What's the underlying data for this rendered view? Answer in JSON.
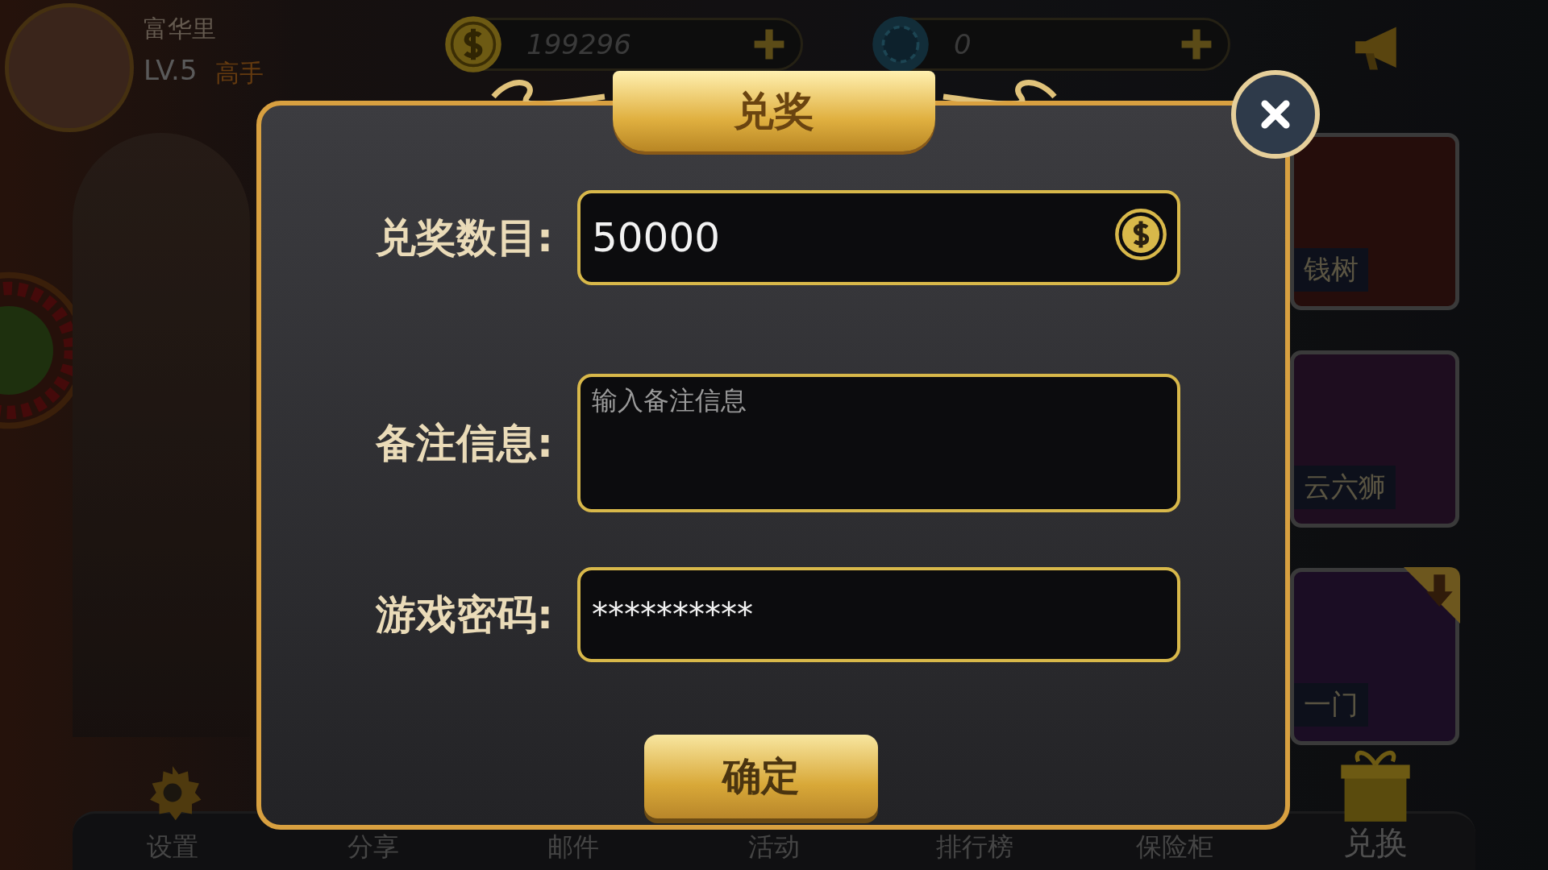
{
  "profile": {
    "name": "富华里",
    "level": "LV.5",
    "rank": "高手"
  },
  "currencies": [
    {
      "kind": "coin",
      "amount": "199296"
    },
    {
      "kind": "chip",
      "amount": "0"
    }
  ],
  "games": [
    {
      "title": "钱树",
      "kind": "coins",
      "download": false
    },
    {
      "title": "云六狮",
      "kind": "lion",
      "download": false
    },
    {
      "title": "一门",
      "kind": "cards",
      "download": true
    }
  ],
  "bottom_nav": [
    {
      "label": "设置",
      "kind": "gear"
    },
    {
      "label": "分享",
      "kind": "plain"
    },
    {
      "label": "邮件",
      "kind": "plain"
    },
    {
      "label": "活动",
      "kind": "plain"
    },
    {
      "label": "排行榜",
      "kind": "plain"
    },
    {
      "label": "保险柜",
      "kind": "plain"
    },
    {
      "label": "兑换",
      "kind": "gift"
    }
  ],
  "dialog": {
    "title": "兑奖",
    "fields": [
      {
        "label": "兑奖数目:",
        "kind": "amount",
        "value": "50000"
      },
      {
        "label": "备注信息:",
        "kind": "multiline",
        "placeholder": "输入备注信息"
      },
      {
        "label": "游戏密码:",
        "kind": "password",
        "value": "**********"
      }
    ],
    "confirm": "确定"
  }
}
